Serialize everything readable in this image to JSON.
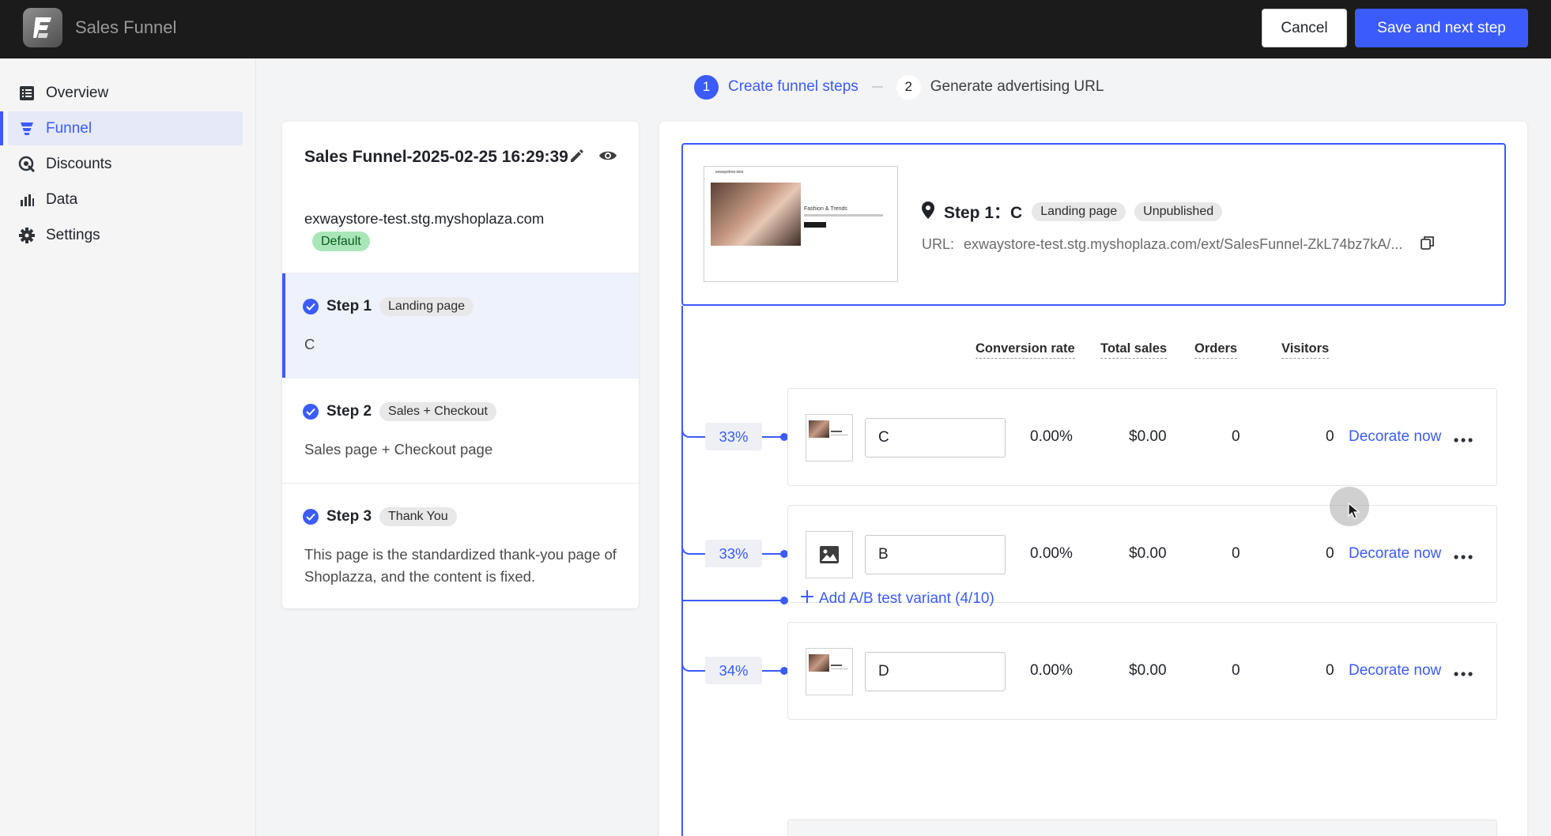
{
  "app": {
    "title": "Sales Funnel",
    "logo_icon": "funnel-logo-icon"
  },
  "header": {
    "cancel_label": "Cancel",
    "save_label": "Save and next step"
  },
  "sidebar": {
    "items": [
      {
        "label": "Overview",
        "icon": "list-icon",
        "active": false
      },
      {
        "label": "Funnel",
        "icon": "funnel-icon",
        "active": true
      },
      {
        "label": "Discounts",
        "icon": "discount-icon",
        "active": false
      },
      {
        "label": "Data",
        "icon": "bar-chart-icon",
        "active": false
      },
      {
        "label": "Settings",
        "icon": "gear-icon",
        "active": false
      }
    ]
  },
  "stepper": {
    "steps": [
      {
        "number": "1",
        "label": "Create funnel steps",
        "active": true
      },
      {
        "number": "2",
        "label": "Generate advertising URL",
        "active": false
      }
    ]
  },
  "funnel": {
    "name": "Sales Funnel-2025-02-25 16:29:39",
    "domain": "exwaystore-test.stg.myshoplaza.com",
    "default_badge": "Default",
    "steps": [
      {
        "name": "Step 1",
        "type": "Landing page",
        "description": "C"
      },
      {
        "name": "Step 2",
        "type": "Sales + Checkout",
        "description": "Sales page + Checkout page"
      },
      {
        "name": "Step 3",
        "type": "Thank You",
        "description": "This page is the standardized thank-you page of Shoplazza, and the content is fixed."
      }
    ]
  },
  "detail": {
    "step_title": "Step 1：C",
    "type_badge": "Landing page",
    "status_badge": "Unpublished",
    "url_label": "URL:",
    "url_value": "exwaystore-test.stg.myshoplaza.com/ext/SalesFunnel-ZkL74bz7kA/...",
    "preview": {
      "store_name": "exwaystore-test",
      "headline": "Fashion & Trends"
    },
    "columns": [
      "Conversion rate",
      "Total sales",
      "Orders",
      "Visitors"
    ],
    "variants": [
      {
        "percent": "33%",
        "name": "C",
        "conversion": "0.00%",
        "sales": "$0.00",
        "orders": "0",
        "visitors": "0",
        "action": "Decorate now",
        "thumb": "page-preview"
      },
      {
        "percent": "33%",
        "name": "B",
        "conversion": "0.00%",
        "sales": "$0.00",
        "orders": "0",
        "visitors": "0",
        "action": "Decorate now",
        "thumb": "image-placeholder-icon"
      },
      {
        "percent": "34%",
        "name": "D",
        "conversion": "0.00%",
        "sales": "$0.00",
        "orders": "0",
        "visitors": "0",
        "action": "Decorate now",
        "thumb": "page-preview"
      }
    ],
    "add_variant_label": "Add A/B test variant (4/10)"
  },
  "colors": {
    "accent": "#3b5bfd",
    "topbar": "#1b1b1b",
    "default_badge_bg": "#a9e6b7"
  }
}
